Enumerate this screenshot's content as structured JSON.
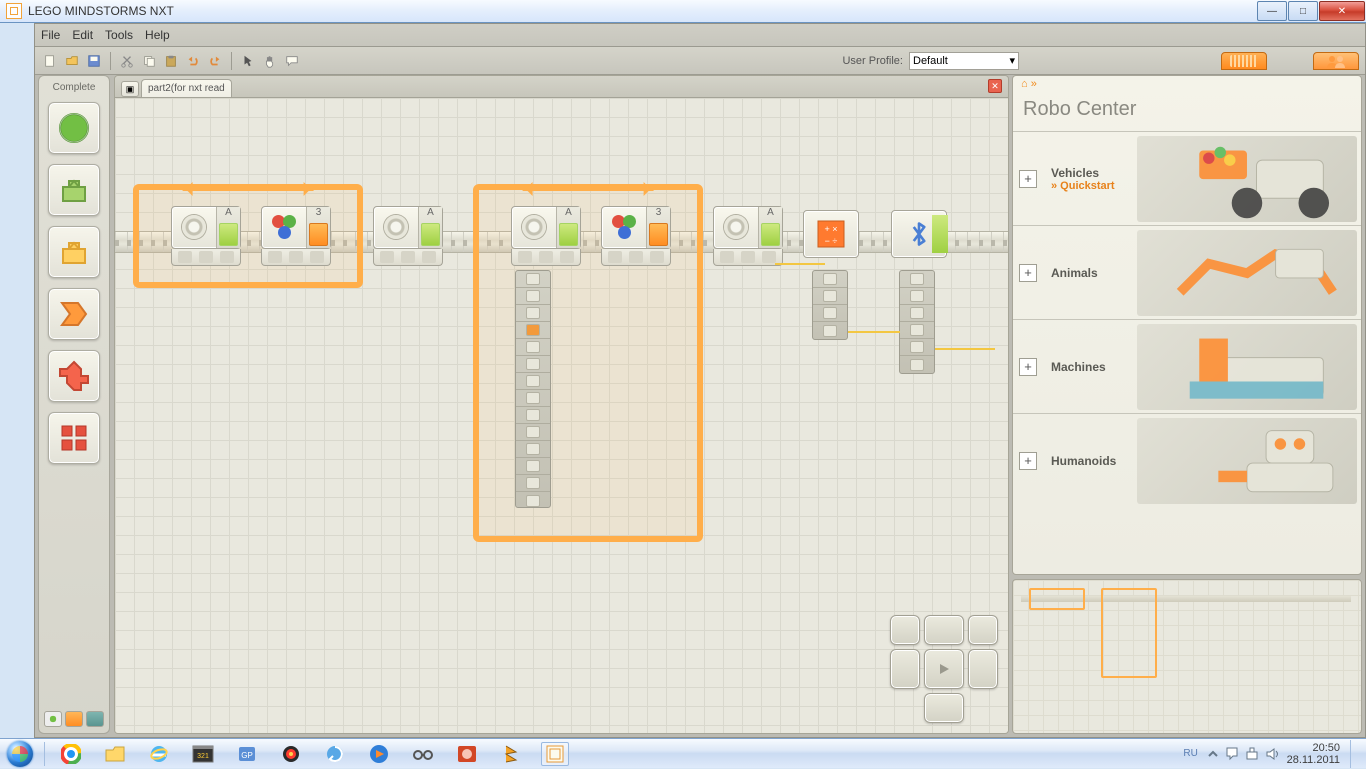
{
  "window": {
    "title": "LEGO MINDSTORMS NXT"
  },
  "menu": {
    "file": "File",
    "edit": "Edit",
    "tools": "Tools",
    "help": "Help"
  },
  "userprofile": {
    "label": "User Profile:",
    "value": "Default"
  },
  "palette": {
    "mode_label": "Complete"
  },
  "document": {
    "tab_label": "part2(for nxt read"
  },
  "robo_center": {
    "home_glyph": "⌂ »",
    "title": "Robo Center",
    "items": [
      {
        "name": "Vehicles",
        "sub": "» Quickstart"
      },
      {
        "name": "Animals",
        "sub": ""
      },
      {
        "name": "Machines",
        "sub": ""
      },
      {
        "name": "Humanoids",
        "sub": ""
      }
    ]
  },
  "blocks": {
    "port_a": "A",
    "port_3": "3"
  },
  "system": {
    "language": "RU",
    "clock_time": "20:50",
    "clock_date": "28.11.2011"
  }
}
